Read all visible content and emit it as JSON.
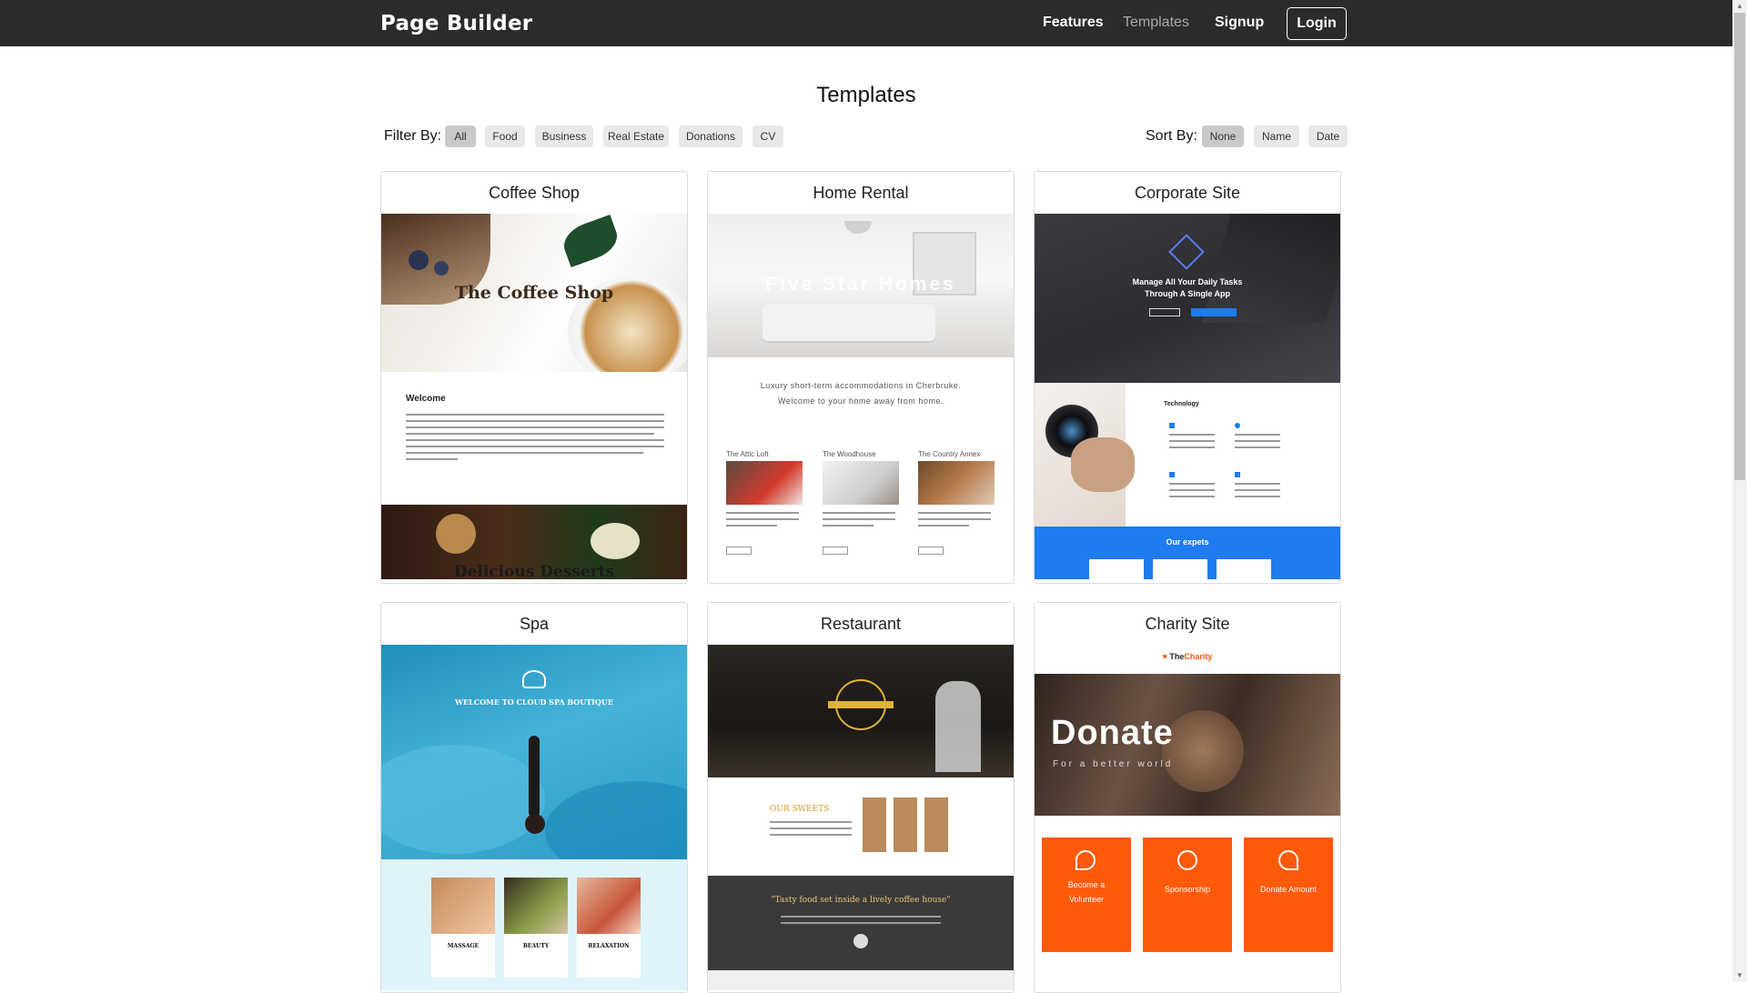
{
  "nav": {
    "brand": "Page Builder",
    "links": [
      "Features",
      "Templates",
      "Signup"
    ],
    "login": "Login"
  },
  "page": {
    "title": "Templates"
  },
  "filter": {
    "label": "Filter By:",
    "options": [
      "All",
      "Food",
      "Business",
      "Real Estate",
      "Donations",
      "CV"
    ],
    "selected": "All"
  },
  "sort": {
    "label": "Sort By:",
    "options": [
      "None",
      "Name",
      "Date"
    ],
    "selected": "None"
  },
  "templates": [
    {
      "title": "Coffee Shop",
      "preview": {
        "hero": "The Coffee Shop",
        "section": "Welcome",
        "footer": "Delicious Desserts"
      }
    },
    {
      "title": "Home Rental",
      "preview": {
        "hero": "Five Star Homes",
        "tagline1": "Luxury short-term accommodations in Cherbruke.",
        "tagline2": "Welcome to your home away from home.",
        "listings": [
          "The Attic Loft",
          "The Woodhouse",
          "The Country Annex"
        ]
      }
    },
    {
      "title": "Corporate Site",
      "preview": {
        "hero1": "Manage All Your Daily Tasks",
        "hero2": "Through A Single App",
        "section": "Technology",
        "band": "Our expets"
      }
    },
    {
      "title": "Spa",
      "preview": {
        "hero": "WELCOME TO CLOUD SPA BOUTIQUE",
        "cards": [
          "MASSAGE",
          "BEAUTY",
          "RELAXATION"
        ]
      }
    },
    {
      "title": "Restaurant",
      "preview": {
        "section": "OUR SWEETS",
        "quote": "\"Tasty food set inside a lively coffee house\""
      }
    },
    {
      "title": "Charity Site",
      "preview": {
        "logo_prefix": "The",
        "logo_suffix": "Charity",
        "hero": "Donate",
        "subhero": "For a better world",
        "cards": [
          "Become a Volunteer",
          "Sponsorship",
          "Donate Amount"
        ]
      }
    }
  ],
  "colors": {
    "navbar": "#2b2b2b",
    "corporate_accent": "#1e7bf0",
    "charity_orange": "#ff5a0a",
    "spa_blue": "#3aa7cf"
  }
}
